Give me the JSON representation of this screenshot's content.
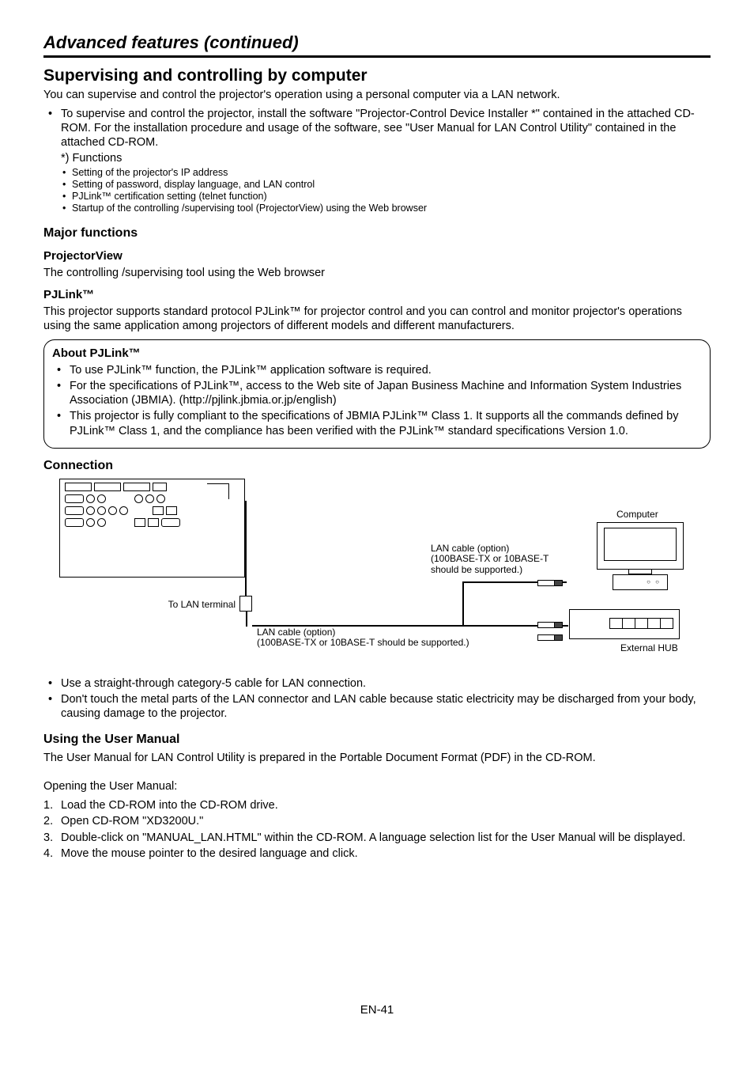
{
  "header": {
    "title": "Advanced features (continued)"
  },
  "supervise": {
    "title": "Supervising and controlling by computer",
    "intro": "You can supervise and control the projector's operation using a personal computer via a LAN network.",
    "bullet1": "To supervise and control the projector, install the software \"Projector-Control Device Installer *\" contained in the attached CD-ROM. For the installation procedure and usage of the software, see \"User Manual for LAN Control Utility\" contained in the attached CD-ROM.",
    "functions_label": "*) Functions",
    "func": {
      "a": "Setting of the projector's IP address",
      "b": "Setting of password, display language, and LAN control",
      "c": "PJLink™ certification setting (telnet function)",
      "d": "Startup of the controlling /supervising tool (ProjectorView) using the Web browser"
    }
  },
  "major": {
    "title": "Major functions",
    "pv_title": "ProjectorView",
    "pv_text": "The controlling /supervising tool using the Web browser",
    "pj_title": "PJLink™",
    "pj_text": "This projector supports standard protocol PJLink™ for projector control and you can control and monitor projector's operations using the same application among projectors of different models and different manufacturers."
  },
  "about": {
    "title": "About PJLink™",
    "b1": "To use PJLink™ function, the PJLink™ application software is required.",
    "b2": "For the specifications of PJLink™, access to the Web site of Japan Business Machine and Information System Industries Association (JBMIA). (http://pjlink.jbmia.or.jp/english)",
    "b3": "This projector is fully compliant to the specifications of JBMIA PJLink™ Class 1. It supports all the commands defined by PJLink™ Class 1, and the compliance has been verified with the PJLink™ standard specifications Version 1.0."
  },
  "connection": {
    "title": "Connection",
    "diagram": {
      "computer": "Computer",
      "ext_hub": "External HUB",
      "to_lan": "To LAN terminal",
      "cable1a": "LAN cable (option)",
      "cable1b": "(100BASE-TX or 10BASE-T should be supported.)",
      "cable2a": "LAN cable (option)",
      "cable2b": "(100BASE-TX or 10BASE-T should be supported.)"
    },
    "note1": "Use a straight-through category-5 cable for LAN connection.",
    "note2": "Don't touch the metal parts of the LAN connector and LAN cable because static electricity may be discharged from your body, causing damage to the projector."
  },
  "manual": {
    "title": "Using the User Manual",
    "intro": "The User Manual for LAN Control Utility is prepared in the Portable Document Format (PDF) in the CD-ROM.",
    "opening": "Opening the User Manual:",
    "s1": "Load the CD-ROM into the CD-ROM drive.",
    "s2": "Open CD-ROM \"XD3200U.\"",
    "s3": "Double-click on \"MANUAL_LAN.HTML\" within the CD-ROM. A language selection list for the User Manual will be displayed.",
    "s4": "Move the mouse pointer to the desired language and click."
  },
  "footer": {
    "page": "EN-41"
  }
}
